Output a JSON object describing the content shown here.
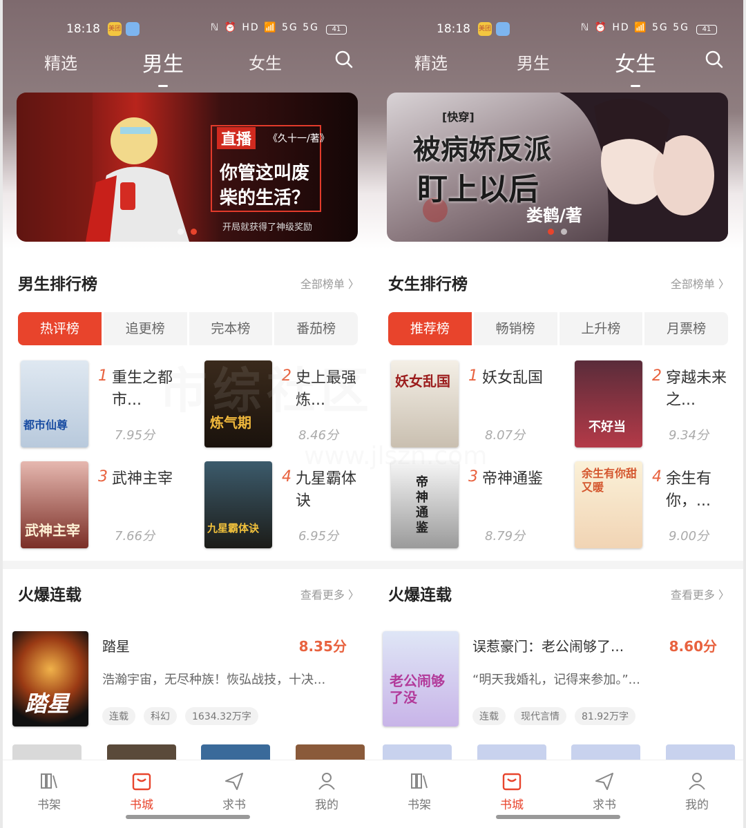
{
  "status": {
    "time": "18:18",
    "badge": "美团",
    "network": "ℕ ⏰ HD 📶 5G 5G",
    "battery": "41"
  },
  "watermark": {
    "main": "市综社区",
    "url": "www.jlszn.com"
  },
  "left": {
    "nav": [
      "精选",
      "男生",
      "女生"
    ],
    "banner": {
      "tag": "直播",
      "author": "《久十一/著》",
      "line1": "你管这叫废",
      "line2": "柴的生活？",
      "sub": "开局就获得了神级奖励"
    },
    "rank_title": "男生排行榜",
    "rank_more": "全部榜单 〉",
    "tabs": [
      "热评榜",
      "追更榜",
      "完本榜",
      "番茄榜"
    ],
    "ranks": [
      {
        "num": "1",
        "name": "重生之都市...",
        "score": "7.95分",
        "cover": "都市仙尊"
      },
      {
        "num": "2",
        "name": "史上最强炼...",
        "score": "8.46分",
        "cover": "炼气期"
      },
      {
        "num": "3",
        "name": "武神主宰",
        "score": "7.66分",
        "cover": "武神主宰"
      },
      {
        "num": "4",
        "name": "九星霸体诀",
        "score": "6.95分",
        "cover": "九星霸体诀"
      }
    ],
    "serial_title": "火爆连载",
    "serial_more": "查看更多 〉",
    "featured": {
      "title": "踏星",
      "score": "8.35分",
      "desc": "浩瀚宇宙，无尽种族！恢弘战技，十决...",
      "tags": [
        "连载",
        "科幻",
        "1634.32万字"
      ],
      "cover": "踏星"
    },
    "tabbar": [
      "书架",
      "书城",
      "求书",
      "我的"
    ]
  },
  "right": {
    "nav": [
      "精选",
      "男生",
      "女生"
    ],
    "banner": {
      "tag": "[快穿]",
      "line1": "被病娇反派",
      "line2": "盯上以后",
      "author": "娄鹤/著"
    },
    "rank_title": "女生排行榜",
    "rank_more": "全部榜单 〉",
    "tabs": [
      "推荐榜",
      "畅销榜",
      "上升榜",
      "月票榜"
    ],
    "ranks": [
      {
        "num": "1",
        "name": "妖女乱国",
        "score": "8.07分",
        "cover": "妖女乱国"
      },
      {
        "num": "2",
        "name": "穿越未来之...",
        "score": "9.34分",
        "cover": "不好当"
      },
      {
        "num": "3",
        "name": "帝神通鉴",
        "score": "8.79分",
        "cover": "帝神通鉴"
      },
      {
        "num": "4",
        "name": "余生有你，...",
        "score": "9.00分",
        "cover": "余生有你甜又暖"
      }
    ],
    "serial_title": "火爆连载",
    "serial_more": "查看更多 〉",
    "featured": {
      "title": "误惹豪门：老公闹够了...",
      "score": "8.60分",
      "desc": "“明天我婚礼，记得来参加。”...",
      "tags": [
        "连载",
        "现代言情",
        "81.92万字"
      ],
      "cover": "老公闹够了没"
    },
    "tabbar": [
      "书架",
      "书城",
      "求书",
      "我的"
    ]
  },
  "colors": {
    "accent": "#e8442c",
    "score": "#e8623f"
  }
}
